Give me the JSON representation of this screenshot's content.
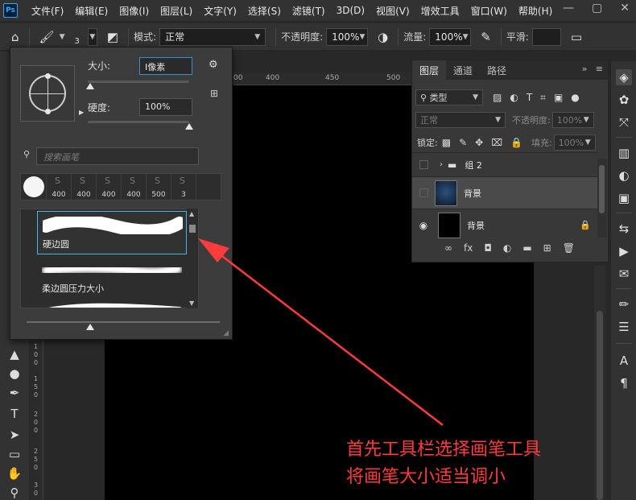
{
  "app": {
    "logo_text": "Ps"
  },
  "menu": [
    "文件(F)",
    "编辑(E)",
    "图像(I)",
    "图层(L)",
    "文字(Y)",
    "选择(S)",
    "滤镜(T)",
    "3D(D)",
    "视图(V)",
    "增效工具",
    "窗口(W)",
    "帮助(H)"
  ],
  "window_controls": {
    "minimize": "—",
    "maximize": "▢",
    "close": "✕"
  },
  "options_bar": {
    "brush_size_value": "3",
    "mode_label": "模式:",
    "mode_value": "正常",
    "opacity_label": "不透明度:",
    "opacity_value": "100%",
    "flow_label": "流量:",
    "flow_value": "100%",
    "smoothing_label": "平滑:"
  },
  "brush_popup": {
    "size_label": "大小:",
    "size_value": "像素",
    "size_slider_fraction": 0.02,
    "hardness_label": "硬度:",
    "hardness_value": "100%",
    "hardness_slider_fraction": 1.0,
    "search_placeholder": "搜索画笔",
    "recent_sizes": [
      "400",
      "400",
      "400",
      "400",
      "500",
      "3"
    ],
    "brushes": [
      {
        "name": "硬边圆",
        "selected": true
      },
      {
        "name": "柔边圆压力大小",
        "selected": false
      }
    ]
  },
  "ruler": {
    "h_ticks": [
      "00",
      "400",
      "450",
      "500"
    ],
    "v_ticks": [
      "1",
      "0",
      "0",
      "1",
      "5",
      "0",
      "2",
      "0",
      "0",
      "2",
      "5",
      "0",
      "3",
      "0"
    ]
  },
  "layers_panel": {
    "tabs": [
      "图层",
      "通道",
      "路径"
    ],
    "filter_label": "类型",
    "blend_mode": "正常",
    "opacity_label": "不透明度:",
    "opacity_value": "100%",
    "lock_label": "锁定:",
    "fill_label": "填充:",
    "fill_value": "100%",
    "layers": [
      {
        "name": "组 2",
        "type": "group",
        "visible": false
      },
      {
        "name": "背景",
        "type": "image",
        "visible": false,
        "selected": true
      },
      {
        "name": "背景",
        "type": "background",
        "visible": true,
        "locked": true
      }
    ]
  },
  "annotation": {
    "line1": "首先工具栏选择画笔工具",
    "line2": "将画笔大小适当调小",
    "color": "#ff3b3b"
  }
}
